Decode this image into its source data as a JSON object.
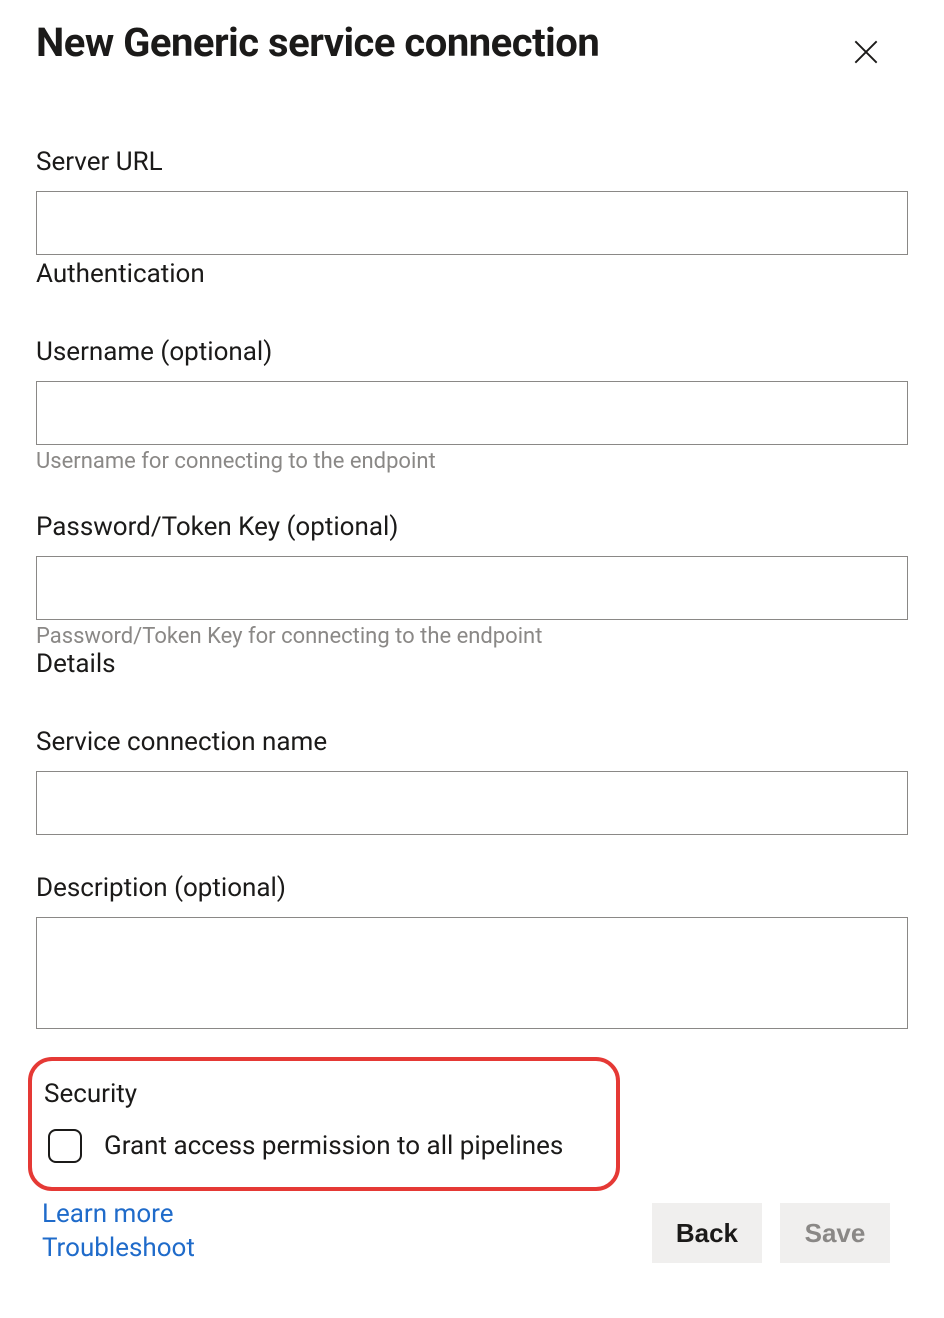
{
  "dialog": {
    "title": "New Generic service connection"
  },
  "fields": {
    "server_url": {
      "label": "Server URL",
      "value": ""
    },
    "authentication_heading": "Authentication",
    "username": {
      "label": "Username (optional)",
      "value": "",
      "hint": "Username for connecting to the endpoint"
    },
    "password": {
      "label": "Password/Token Key (optional)",
      "value": "",
      "hint": "Password/Token Key for connecting to the endpoint"
    },
    "details_heading": "Details",
    "name": {
      "label": "Service connection name",
      "value": ""
    },
    "description": {
      "label": "Description (optional)",
      "value": ""
    }
  },
  "security": {
    "heading": "Security",
    "grant_all_label": "Grant access permission to all pipelines",
    "grant_all_checked": false
  },
  "footer": {
    "learn_more": "Learn more",
    "troubleshoot": "Troubleshoot",
    "back": "Back",
    "save": "Save"
  }
}
